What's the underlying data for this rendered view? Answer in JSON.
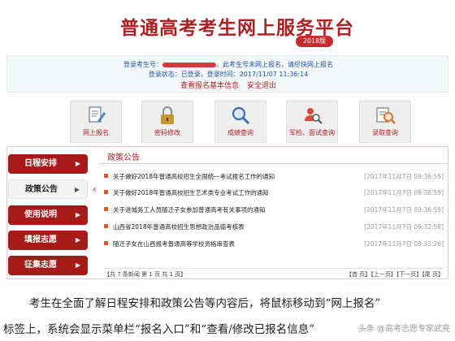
{
  "header": {
    "title": "普通高考考生网上服务平台",
    "year_badge": "2018版"
  },
  "login": {
    "number_label": "登录考生号：",
    "number_note": "，此考生号未网上报名，请尽快网上报名",
    "status_label": "登录状态：",
    "status_value": "已登录，",
    "time_label": "登录时间：",
    "time_value": "2017/11/07 11:36:14",
    "view_info_link": "查看报名基本信息",
    "logout_link": "安全退出"
  },
  "menu": [
    {
      "label": "网上报名",
      "icon": "form-edit-icon"
    },
    {
      "label": "密码修改",
      "icon": "padlock-icon"
    },
    {
      "label": "成绩查询",
      "icon": "magnifier-icon"
    },
    {
      "label": "军检、面试查询",
      "icon": "person-search-icon"
    },
    {
      "label": "录取查询",
      "icon": "admission-search-icon"
    }
  ],
  "sidebar": {
    "items": [
      {
        "label": "日程安排",
        "arrow": "▶"
      },
      {
        "label": "政策公告",
        "arrow": "▶"
      },
      {
        "label": "使用说明",
        "arrow": "▶"
      },
      {
        "label": "填报志愿",
        "arrow": "▶"
      },
      {
        "label": "征集志愿",
        "arrow": "▶"
      }
    ],
    "active_index": 1
  },
  "policy": {
    "heading": "政策公告",
    "items": [
      {
        "title": "关于做好2018年普通高校招生全国统一考试报名工作的通知",
        "date": "[2017年11月7日 09:36:55]"
      },
      {
        "title": "关于做好2018年普通高校招生艺术类专业考试工作的通知",
        "date": "[2017年11月7日 09:36:55]"
      },
      {
        "title": "关于进城务工人员随迁子女参加普通高考有关事项的通知",
        "date": "[2017年11月7日 09:36:55]"
      },
      {
        "title": "山西省2018年普通高校招生思想政治品德考核表",
        "date": "[2017年11月7日 09:32:58]"
      },
      {
        "title": "随迁子女在山西报考普通高等学校资格审查表",
        "date": "[2017年11月7日 09:33:26]"
      }
    ],
    "pager": "【共 7 条新闻    第 1 页    共 1 页】",
    "pager_nav": "【首 页】【上一页】【下一页】【尾 页】"
  },
  "caption": {
    "line1": "考生在全面了解日程安排和政策公告等内容后，将鼠标移动到“网上报名”",
    "line2": "标签上，系统会显示菜单栏“报名入口”和“查看/修改已报名信息”",
    "watermark": "头条 @高考志愿专家武亮"
  },
  "colors": {
    "brand_red": "#b01f22",
    "link_blue": "#1f55a6",
    "sidebar_red": "#a61a1a"
  }
}
